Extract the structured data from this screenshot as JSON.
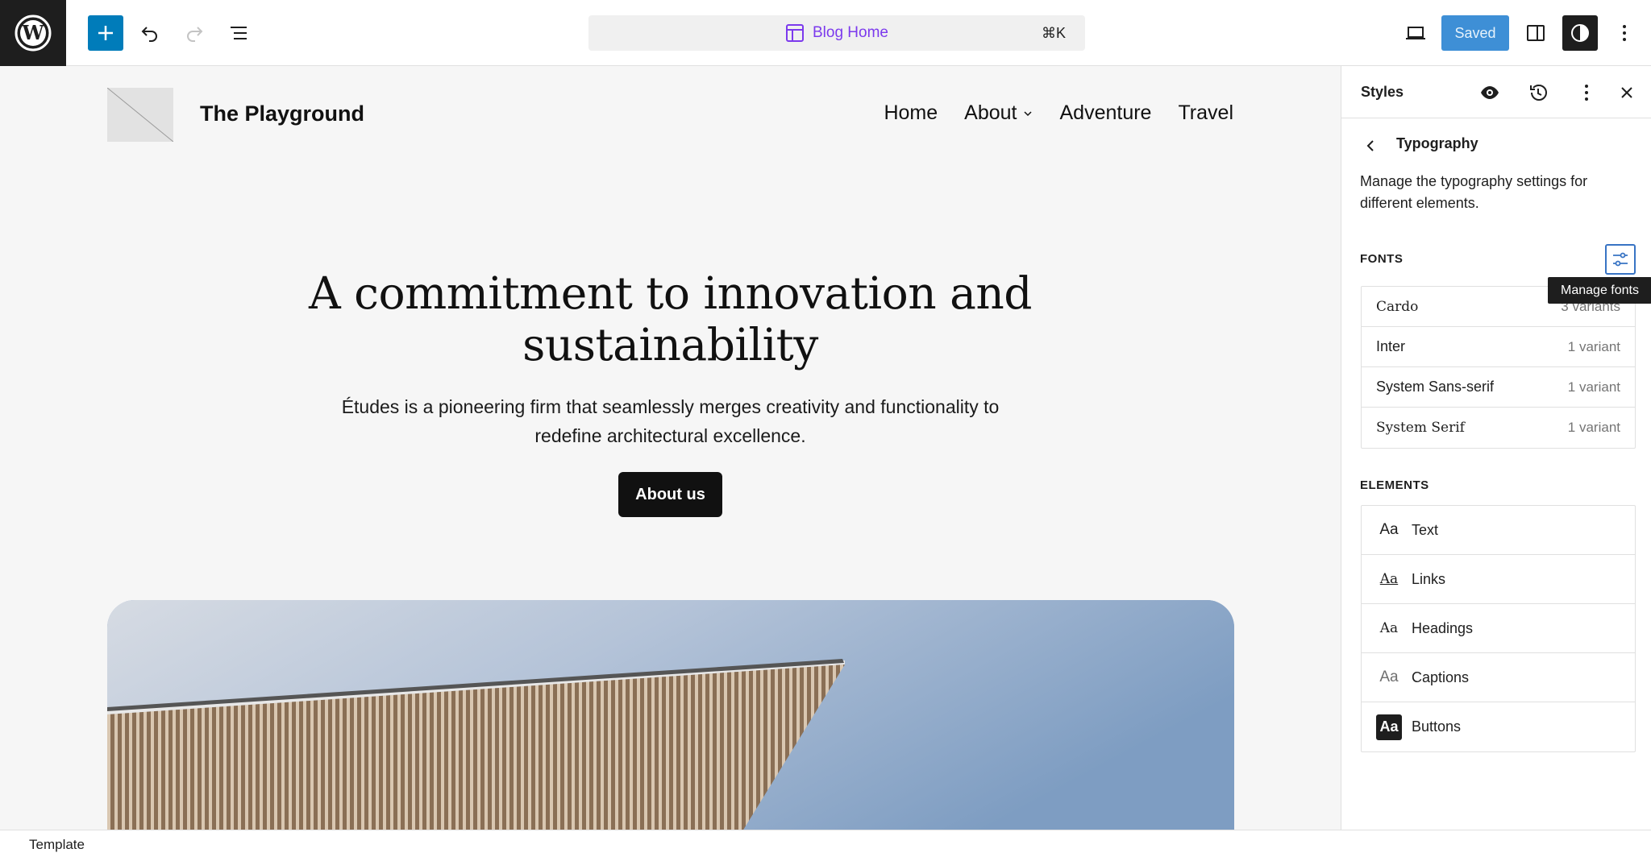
{
  "toolbar": {
    "command_title": "Blog Home",
    "command_shortcut": "⌘K",
    "saved_label": "Saved"
  },
  "canvas": {
    "site_title": "The Playground",
    "nav": [
      "Home",
      "About",
      "Adventure",
      "Travel"
    ],
    "hero_title": "A commitment to innovation and sustainability",
    "hero_text": "Études is a pioneering firm that seamlessly merges creativity and functionality to redefine architectural excellence.",
    "hero_button": "About us"
  },
  "sidebar": {
    "title": "Styles",
    "section_title": "Typography",
    "section_description": "Manage the typography settings for different elements.",
    "fonts_label": "FONTS",
    "manage_fonts_tooltip": "Manage fonts",
    "fonts": [
      {
        "name": "Cardo",
        "variants": "3 variants"
      },
      {
        "name": "Inter",
        "variants": "1 variant"
      },
      {
        "name": "System Sans-serif",
        "variants": "1 variant"
      },
      {
        "name": "System Serif",
        "variants": "1 variant"
      }
    ],
    "elements_label": "ELEMENTS",
    "element_icon_text": "Aa",
    "elements": [
      {
        "label": "Text"
      },
      {
        "label": "Links"
      },
      {
        "label": "Headings"
      },
      {
        "label": "Captions"
      },
      {
        "label": "Buttons"
      }
    ]
  },
  "footer": {
    "label": "Template"
  },
  "colors": {
    "accent": "#007cba",
    "command_title": "#7c3aed",
    "saved_bg": "#3e8fd6",
    "tooltip_bg": "#1e1e1e"
  }
}
